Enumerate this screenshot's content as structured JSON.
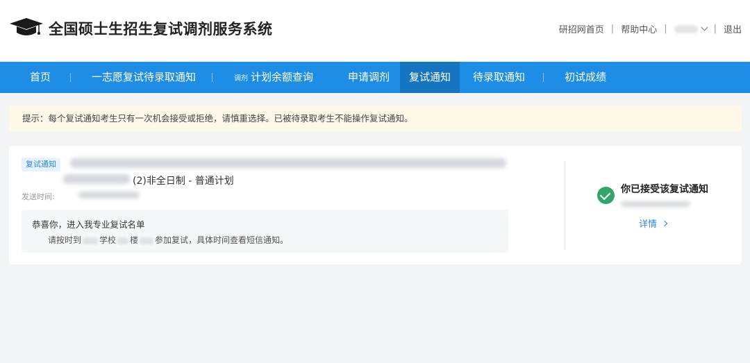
{
  "header": {
    "site_title": "全国硕士生招生复试调剂服务系统",
    "links": {
      "home": "研招网首页",
      "help": "帮助中心",
      "logout": "退出",
      "separator": "|"
    }
  },
  "nav": {
    "items": [
      {
        "label": "首页"
      },
      {
        "label": "一志愿复试待录取通知"
      },
      {
        "tag": "调剂",
        "label": "计划余额查询"
      },
      {
        "label": "申请调剂"
      },
      {
        "label": "复试通知"
      },
      {
        "label": "待录取通知"
      },
      {
        "label": "初试成绩"
      }
    ],
    "active": "复试通知"
  },
  "notice": {
    "text": "提示：每个复试通知考生只有一次机会接受或拒绝，请慎重选择。已被待录取考生不能操作复试通知。"
  },
  "card": {
    "badge": "复试通知",
    "plan": "(2)非全日制 - 普通计划",
    "sent_label": "发送时间:",
    "message": {
      "title": "恭喜你，进入我专业复试名单",
      "body_prefix": "请按时到",
      "body_school": "学校",
      "body_building": "楼",
      "body_suffix": "参加复试，具体时间查看短信通知。"
    },
    "status": {
      "text": "你已接受该复试通知",
      "detail_link": "详情"
    }
  },
  "colors": {
    "nav_bg": "#1e8de6",
    "nav_active": "#1575c2",
    "notice_bg": "#fdf8e7",
    "accent": "#2b87de",
    "success": "#32a66a"
  }
}
